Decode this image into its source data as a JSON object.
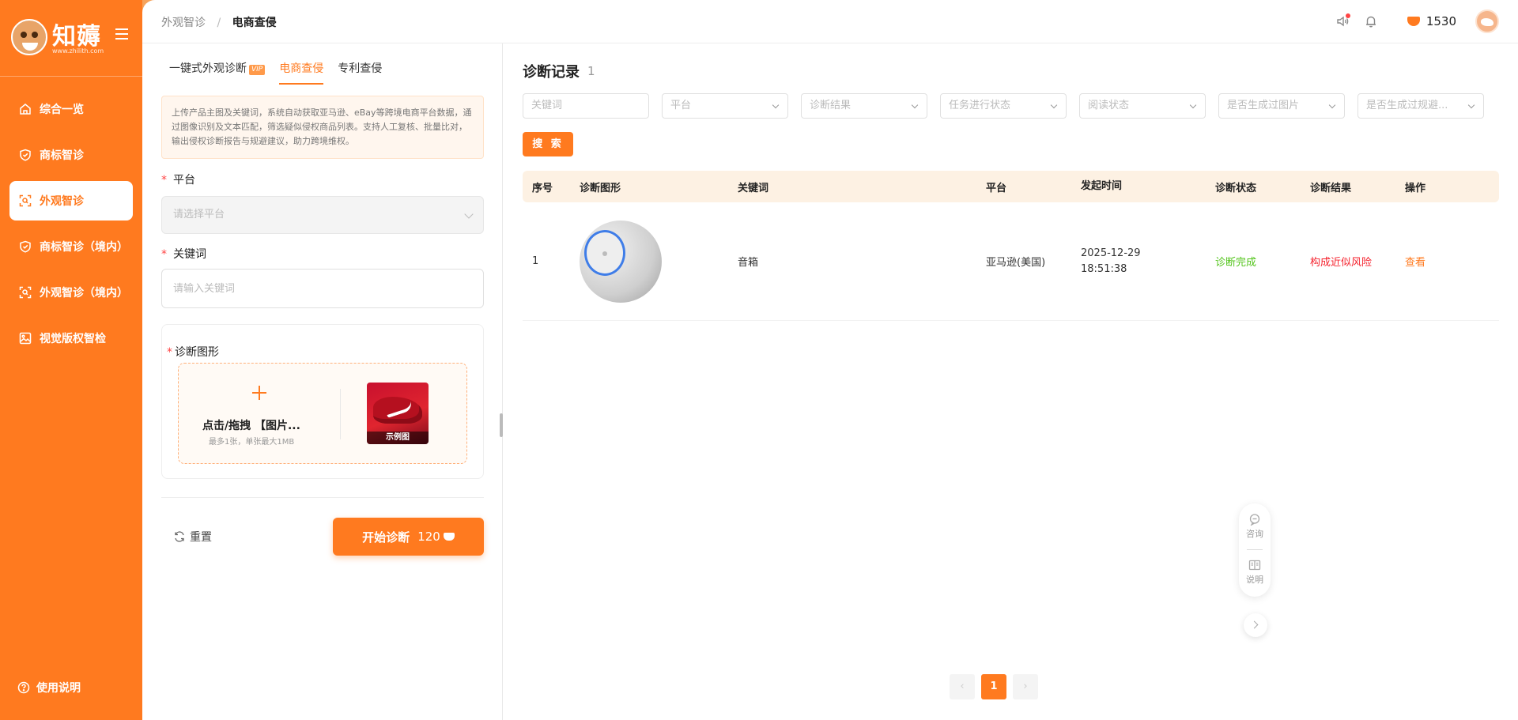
{
  "sidebar": {
    "logo_text": "知薅",
    "logo_url": "www.zhilith.com",
    "items": [
      {
        "label": "综合一览",
        "icon": "home-icon"
      },
      {
        "label": "商标智诊",
        "icon": "shield-icon"
      },
      {
        "label": "外观智诊",
        "icon": "scan-icon",
        "active": true
      },
      {
        "label": "商标智诊（境内）",
        "icon": "shield-icon"
      },
      {
        "label": "外观智诊（境内）",
        "icon": "scan-icon"
      },
      {
        "label": "视觉版权智检",
        "icon": "image-icon"
      }
    ],
    "help_label": "使用说明"
  },
  "header": {
    "breadcrumb": [
      "外观智诊",
      "电商查侵"
    ],
    "coins": "1530"
  },
  "form": {
    "tabs": [
      {
        "label": "一键式外观诊断",
        "badge": "VIP"
      },
      {
        "label": "电商查侵",
        "active": true
      },
      {
        "label": "专利查侵"
      }
    ],
    "description": "上传产品主图及关键词，系统自动获取亚马逊、eBay等跨境电商平台数据，通过图像识别及文本匹配，筛选疑似侵权商品列表。支持人工复核、批量比对，输出侵权诊断报告与规避建议，助力跨境维权。",
    "platform_label": "平台",
    "platform_placeholder": "请选择平台",
    "keyword_label": "关键词",
    "keyword_placeholder": "请输入关键词",
    "graphic_label": "诊断图形",
    "upload_title": "点击/拖拽 【图片...",
    "upload_sub": "最多1张，单张最大1MB",
    "example_label": "示例图",
    "reset_label": "重置",
    "start_label": "开始诊断",
    "start_cost": "120"
  },
  "records": {
    "title": "诊断记录",
    "count": "1",
    "filters": [
      {
        "placeholder": "关键词",
        "type": "input"
      },
      {
        "placeholder": "平台",
        "type": "select"
      },
      {
        "placeholder": "诊断结果",
        "type": "select"
      },
      {
        "placeholder": "任务进行状态",
        "type": "select"
      },
      {
        "placeholder": "阅读状态",
        "type": "select"
      },
      {
        "placeholder": "是否生成过图片",
        "type": "select"
      },
      {
        "placeholder": "是否生成过规避...",
        "type": "select"
      }
    ],
    "search_label": "搜 索",
    "columns": [
      "序号",
      "诊断图形",
      "关键词",
      "平台",
      "发起时间",
      "诊断状态",
      "诊断结果",
      "操作"
    ],
    "rows": [
      {
        "index": "1",
        "keyword": "音箱",
        "platform": "亚马逊(美国)",
        "date": "2025-12-29",
        "time": "18:51:38",
        "status": "诊断完成",
        "result": "构成近似风险",
        "action": "查看"
      }
    ],
    "pagination": {
      "prev": "‹",
      "current": "1",
      "next": "›"
    }
  },
  "float_tools": {
    "consult_label": "咨询",
    "guide_label": "说明"
  },
  "colors": {
    "brand": "#ff7a1f",
    "success": "#52c41a",
    "danger": "#f5222d"
  }
}
